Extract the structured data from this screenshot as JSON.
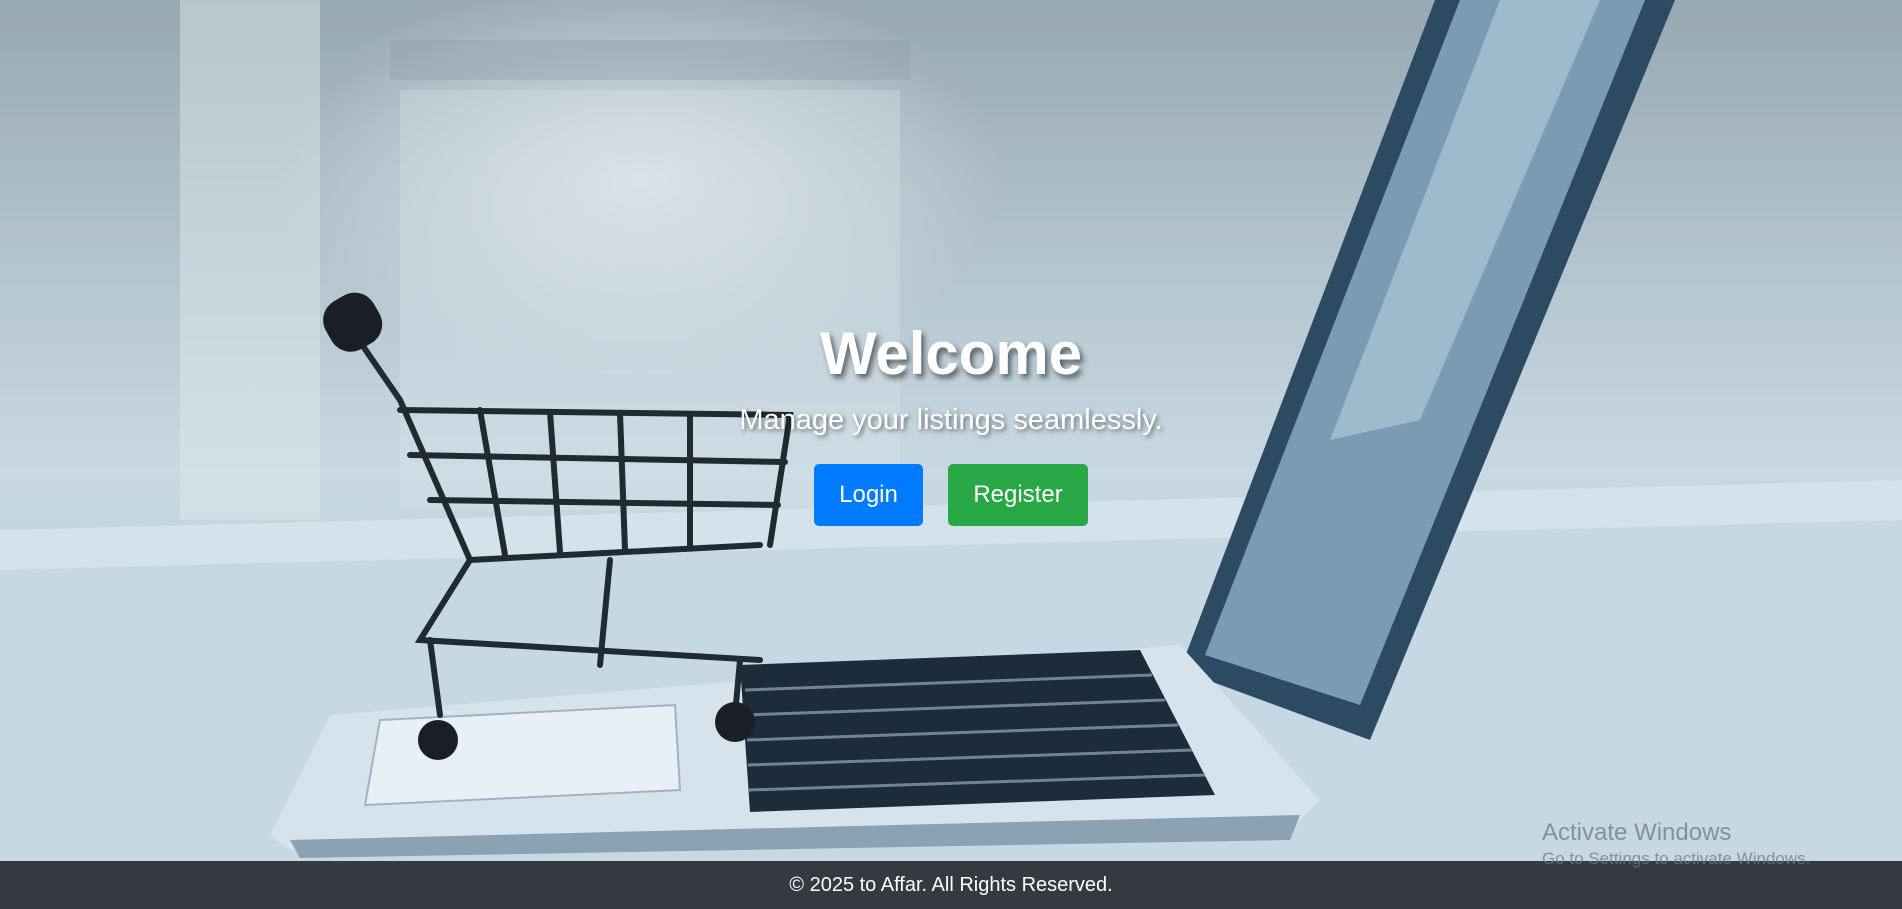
{
  "hero": {
    "title": "Welcome",
    "subtitle": "Manage your listings seamlessly.",
    "login_label": "Login",
    "register_label": "Register",
    "background_image": "shopping-cart-on-laptop"
  },
  "footer": {
    "text": "© 2025 to Affar. All Rights Reserved."
  },
  "os_watermark": {
    "line1": "Activate Windows",
    "line2": "Go to Settings to activate Windows."
  },
  "colors": {
    "login_button": "#007bff",
    "register_button": "#28a745",
    "footer_bg": "#343a40"
  }
}
